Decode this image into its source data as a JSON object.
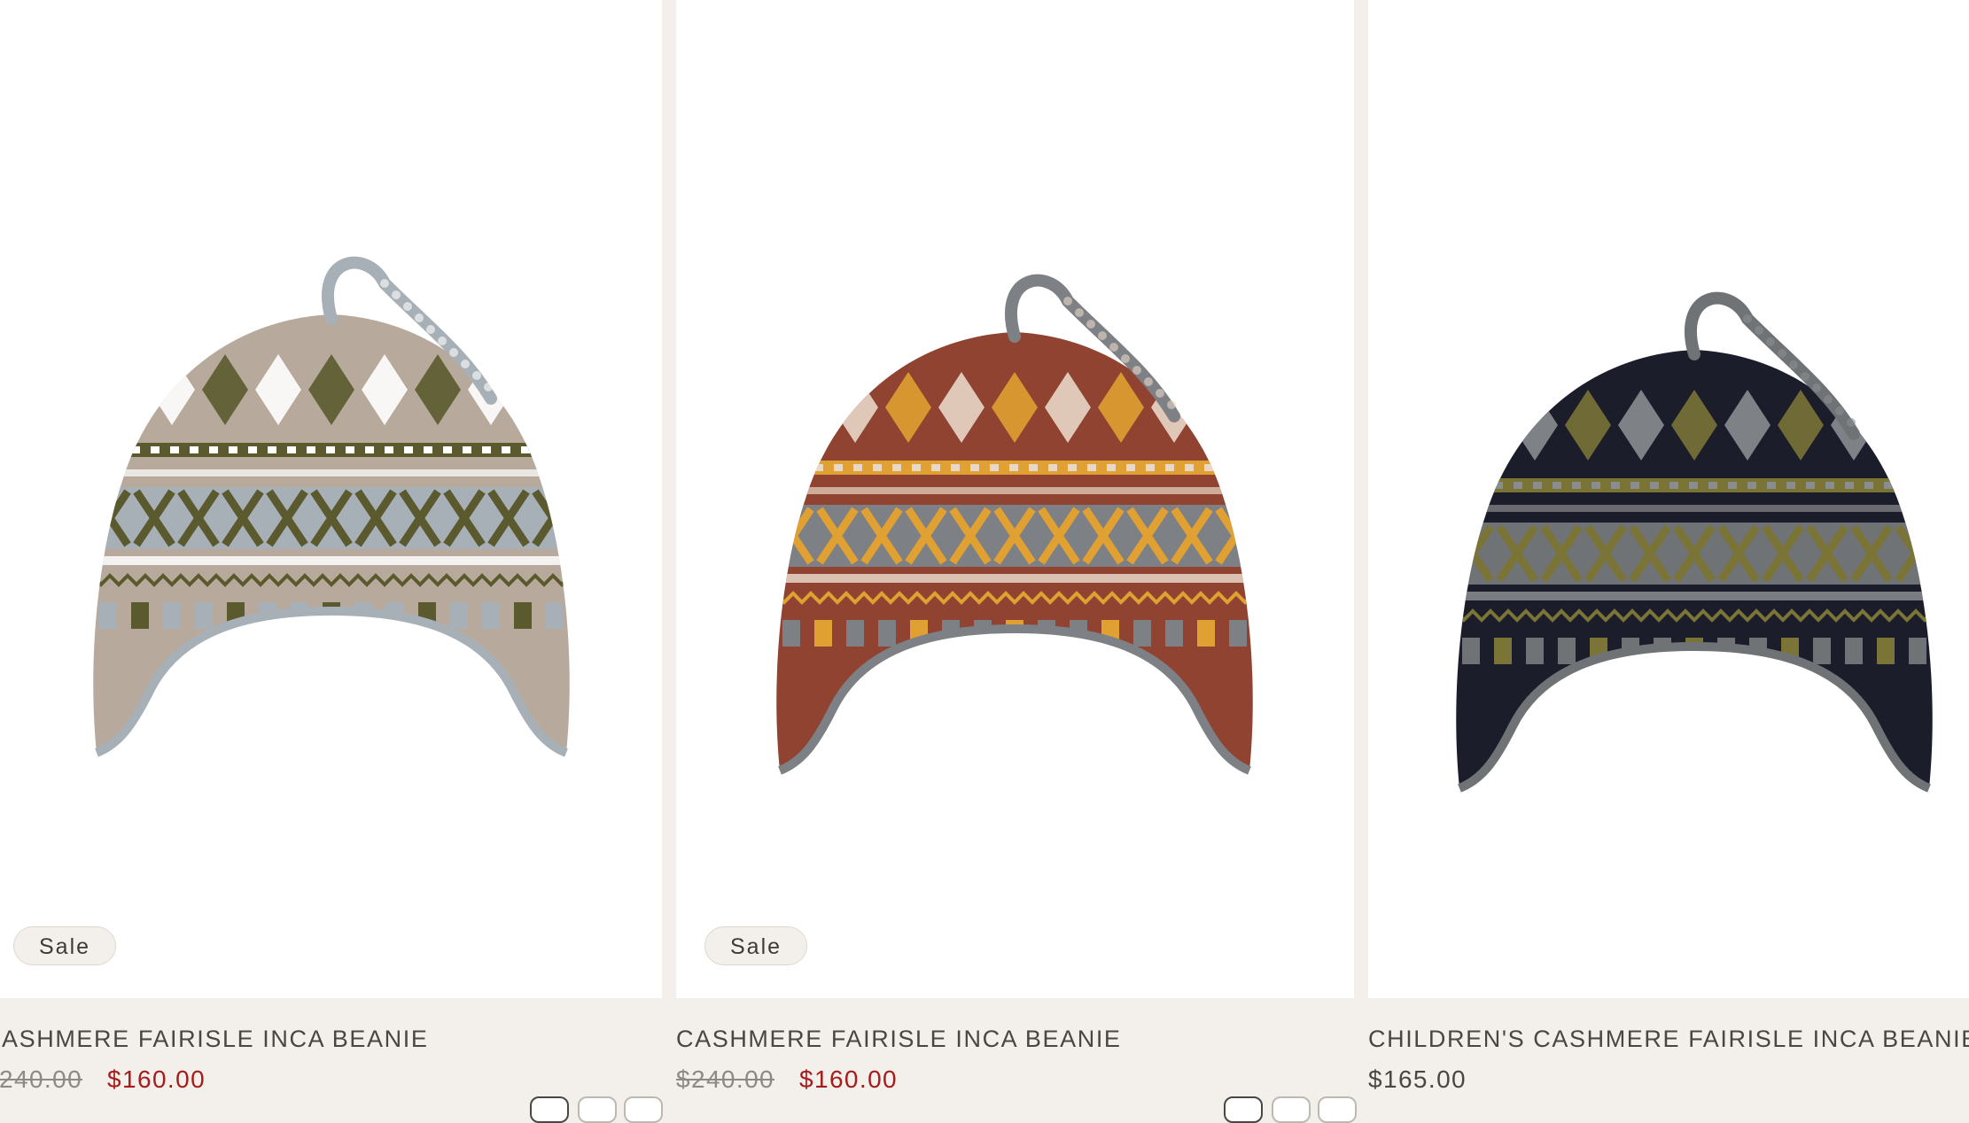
{
  "products": [
    {
      "title": "ASHMERE FAIRISLE INCA BEANIE",
      "badge": "Sale",
      "compare_price": "240.00",
      "price": "$160.00",
      "image": {
        "base": "#b7aa9c",
        "accent": "#5b5a2e",
        "light": "#ffffff",
        "gray": "#a7b0b6"
      }
    },
    {
      "title": "CASHMERE FAIRISLE INCA BEANIE",
      "badge": "Sale",
      "compare_price": "$240.00",
      "price": "$160.00",
      "image": {
        "base": "#8f4330",
        "accent": "#e0a032",
        "light": "#e9d7c8",
        "gray": "#7d8084"
      }
    },
    {
      "title": "CHILDREN'S CASHMERE FAIRISLE INCA BEANIE",
      "badge": "",
      "compare_price": "",
      "price": "$165.00",
      "image": {
        "base": "#1b1d2a",
        "accent": "#7a7437",
        "light": "#8a8d8f",
        "gray": "#6f7376"
      }
    }
  ]
}
